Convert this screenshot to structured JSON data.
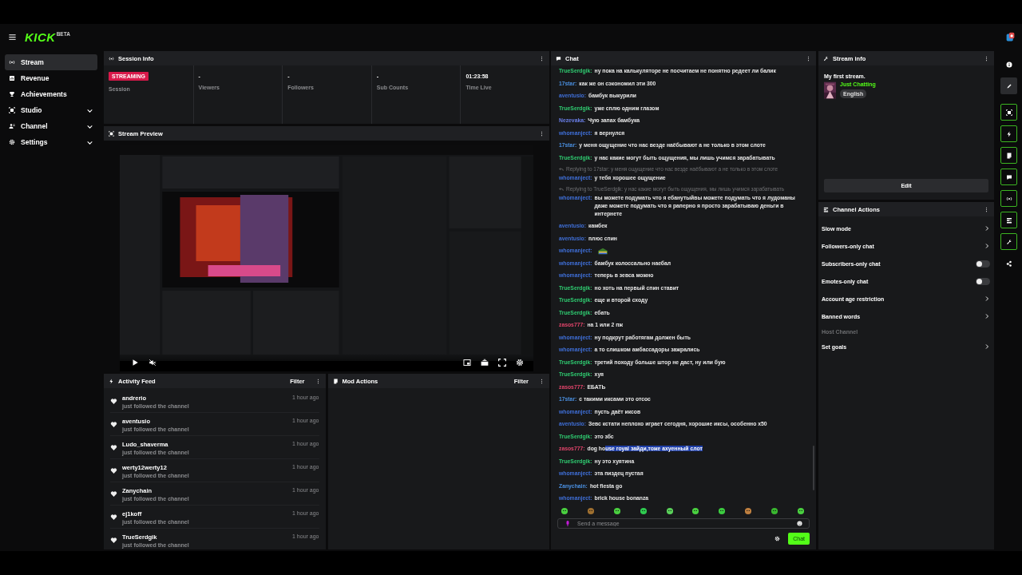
{
  "top_bar": {
    "logo": "KICK",
    "logo_badge": "BETA"
  },
  "sidebar": {
    "items": [
      {
        "label": "Stream",
        "kind": "link",
        "selected": true
      },
      {
        "label": "Revenue",
        "kind": "link",
        "selected": false
      },
      {
        "label": "Achievements",
        "kind": "link",
        "selected": false
      },
      {
        "label": "Studio",
        "kind": "group",
        "selected": false,
        "expanded": false
      },
      {
        "label": "Channel",
        "kind": "group",
        "selected": false,
        "expanded": false
      },
      {
        "label": "Settings",
        "kind": "group",
        "selected": false,
        "expanded": false
      }
    ]
  },
  "session_info": {
    "title": "Session Info",
    "badge": "STREAMING",
    "stats": [
      {
        "label": "Session",
        "kind": "badge"
      },
      {
        "value": "-",
        "label": "Viewers",
        "kind": "value"
      },
      {
        "value": "-",
        "label": "Followers",
        "kind": "value"
      },
      {
        "value": "-",
        "label": "Sub Counts",
        "kind": "value"
      },
      {
        "value": "01:23:58",
        "label": "Time Live",
        "kind": "value"
      }
    ]
  },
  "stream_preview": {
    "title": "Stream Preview",
    "muted": true
  },
  "activity_feed": {
    "title": "Activity Feed",
    "filter": "Filter",
    "items": [
      {
        "user": "andrerio",
        "text": "just followed the channel",
        "time": "1 hour ago"
      },
      {
        "user": "aventusio",
        "text": "just followed the channel",
        "time": "1 hour ago"
      },
      {
        "user": "Ludo_shaverma",
        "text": "just followed the channel",
        "time": "1 hour ago"
      },
      {
        "user": "werty12werty12",
        "text": "just followed the channel",
        "time": "1 hour ago"
      },
      {
        "user": "Zanychain",
        "text": "just followed the channel",
        "time": "1 hour ago"
      },
      {
        "user": "ej1koff",
        "text": "just followed the channel",
        "time": "1 hour ago"
      },
      {
        "user": "TrueSerdgik",
        "text": "just followed the channel",
        "time": "1 hour ago"
      }
    ]
  },
  "mod_actions": {
    "title": "Mod Actions",
    "filter": "Filter"
  },
  "chat": {
    "title": "Chat",
    "messages": [
      {
        "kind": "text",
        "user": "TrueSerdgik:",
        "color": "#2fcc71",
        "text": "ну пока на калькуляторе не посчитаем не понятно редеет ли балик"
      },
      {
        "kind": "text",
        "user": "17star:",
        "color": "#4a8fe0",
        "text": "как же он сэкономил эти 300"
      },
      {
        "kind": "text",
        "user": "aventusio:",
        "color": "#3f6fd8",
        "text": "бамбук выкурили"
      },
      {
        "kind": "text",
        "user": "TrueSerdgik:",
        "color": "#2fcc71",
        "text": "уже сплю одним глазом"
      },
      {
        "kind": "text",
        "user": "Nezevaka:",
        "color": "#6a7fe8",
        "text": "Чую запах бамбука"
      },
      {
        "kind": "text",
        "user": "whomanject:",
        "color": "#3f6fd8",
        "text": "я вернулся"
      },
      {
        "kind": "text",
        "user": "17star:",
        "color": "#4a8fe0",
        "text": "у меня ощущение что нас везде наёбывают а не только в этом слоте"
      },
      {
        "kind": "text",
        "user": "TrueSerdgik:",
        "color": "#2fcc71",
        "text": "у нас какие могут быть ощущения, мы лишь учимся зарабатывать"
      },
      {
        "kind": "text",
        "reply": "Replying to 17star: у меня ощущение что нас везде наёбывают а не только в этом слоте",
        "user": "whomanject:",
        "color": "#3f6fd8",
        "text": "у тебя хорошее ощущение"
      },
      {
        "kind": "text",
        "reply": "Replying to TrueSerdgik: у нас какие могут быть ощущения, мы лишь учимся зарабатывать",
        "user": "whomanject:",
        "color": "#3f6fd8",
        "text": "вы можете подумать что я ебанутыйвы можете подумать что я лудоманы даже можете подумать что я рапернo я просто зарабатываю деньги в интернете"
      },
      {
        "kind": "text",
        "user": "aventusio:",
        "color": "#3f6fd8",
        "text": "камбек"
      },
      {
        "kind": "text",
        "user": "aventusio:",
        "color": "#3f6fd8",
        "text": "плюс спин"
      },
      {
        "kind": "emote",
        "user": "whomanject:",
        "color": "#3f6fd8"
      },
      {
        "kind": "text",
        "user": "whomanject:",
        "color": "#3f6fd8",
        "text": "бамбук колоссально наебал"
      },
      {
        "kind": "text",
        "user": "whomanject:",
        "color": "#3f6fd8",
        "text": "теперь в зевса можно"
      },
      {
        "kind": "text",
        "user": "TrueSerdgik:",
        "color": "#2fcc71",
        "text": "но хоть на первый спин ставит"
      },
      {
        "kind": "text",
        "user": "TrueSerdgik:",
        "color": "#2fcc71",
        "text": "еще и второй сходу"
      },
      {
        "kind": "text",
        "user": "TrueSerdgik:",
        "color": "#2fcc71",
        "text": "ебать"
      },
      {
        "kind": "text",
        "user": "zasos777:",
        "color": "#e0446a",
        "text": "на 1 или 2 пж"
      },
      {
        "kind": "text",
        "user": "whomanject:",
        "color": "#3f6fd8",
        "text": "ну подкрут работягам должен быть"
      },
      {
        "kind": "text",
        "user": "whomanject:",
        "color": "#3f6fd8",
        "text": "а то слишком амбассадоры зажрались"
      },
      {
        "kind": "text",
        "user": "TrueSerdgik:",
        "color": "#2fcc71",
        "text": "третий походу больше штор не даст, ну или бую"
      },
      {
        "kind": "text",
        "user": "TrueSerdgik:",
        "color": "#2fcc71",
        "text": "хуя"
      },
      {
        "kind": "text",
        "user": "zasos777:",
        "color": "#e0446a",
        "text": "ЕБАТЬ"
      },
      {
        "kind": "text",
        "user": "17star:",
        "color": "#4a8fe0",
        "text": "с такими иксами это отсос"
      },
      {
        "kind": "text",
        "user": "whomanject:",
        "color": "#3f6fd8",
        "text": "пусть даёт иксов"
      },
      {
        "kind": "text",
        "user": "aventusio:",
        "color": "#3f6fd8",
        "text": "Зевс кстати неплохо играет сегодня, хорошие иксы, особенно x50"
      },
      {
        "kind": "text",
        "user": "TrueSerdgik:",
        "color": "#2fcc71",
        "text": "это збс"
      },
      {
        "kind": "text",
        "user": "zasos777:",
        "color": "#e0446a",
        "text": "dog ho",
        "selected_text": "use royal зайди,тоже ахуенный слот"
      },
      {
        "kind": "text",
        "user": "TrueSerdgik:",
        "color": "#2fcc71",
        "text": "ну это хуятина"
      },
      {
        "kind": "text",
        "user": "whomanject:",
        "color": "#3f6fd8",
        "text": "эта пиздец пустая"
      },
      {
        "kind": "text",
        "user": "Zanychain:",
        "color": "#4a8fe0",
        "text": "hot fiesta go"
      },
      {
        "kind": "text",
        "user": "whomanject:",
        "color": "#3f6fd8",
        "text": "brick house bonanza"
      }
    ],
    "input": {
      "placeholder": "Send a message"
    },
    "send_button": "Chat"
  },
  "stream_info": {
    "title": "Stream info",
    "stream_title": "My first stream.",
    "category": "Just Chatting",
    "tag": "English",
    "edit_button": "Edit"
  },
  "channel_actions": {
    "title": "Channel Actions",
    "items": [
      {
        "label": "Slow mode",
        "kind": "nav",
        "disabled": false
      },
      {
        "label": "Followers-only chat",
        "kind": "nav",
        "disabled": false
      },
      {
        "label": "Subscribers-only chat",
        "kind": "toggle",
        "on": false,
        "disabled": false
      },
      {
        "label": "Emotes-only chat",
        "kind": "toggle",
        "on": false,
        "disabled": false
      },
      {
        "label": "Account age restriction",
        "kind": "nav",
        "disabled": false
      },
      {
        "label": "Banned words",
        "kind": "nav",
        "disabled": false
      },
      {
        "label": "Host Channel",
        "kind": "nav",
        "disabled": true
      },
      {
        "label": "Set goals",
        "kind": "nav",
        "disabled": false
      }
    ]
  },
  "tool_rail": [
    {
      "selected": false,
      "active": false
    },
    {
      "selected": true,
      "active": false
    },
    {
      "selected": false,
      "active": true
    },
    {
      "selected": false,
      "active": true
    },
    {
      "selected": false,
      "active": true
    },
    {
      "selected": false,
      "active": true
    },
    {
      "selected": false,
      "active": true
    },
    {
      "selected": false,
      "active": true
    },
    {
      "selected": false,
      "active": true
    },
    {
      "selected": false,
      "active": false
    }
  ]
}
